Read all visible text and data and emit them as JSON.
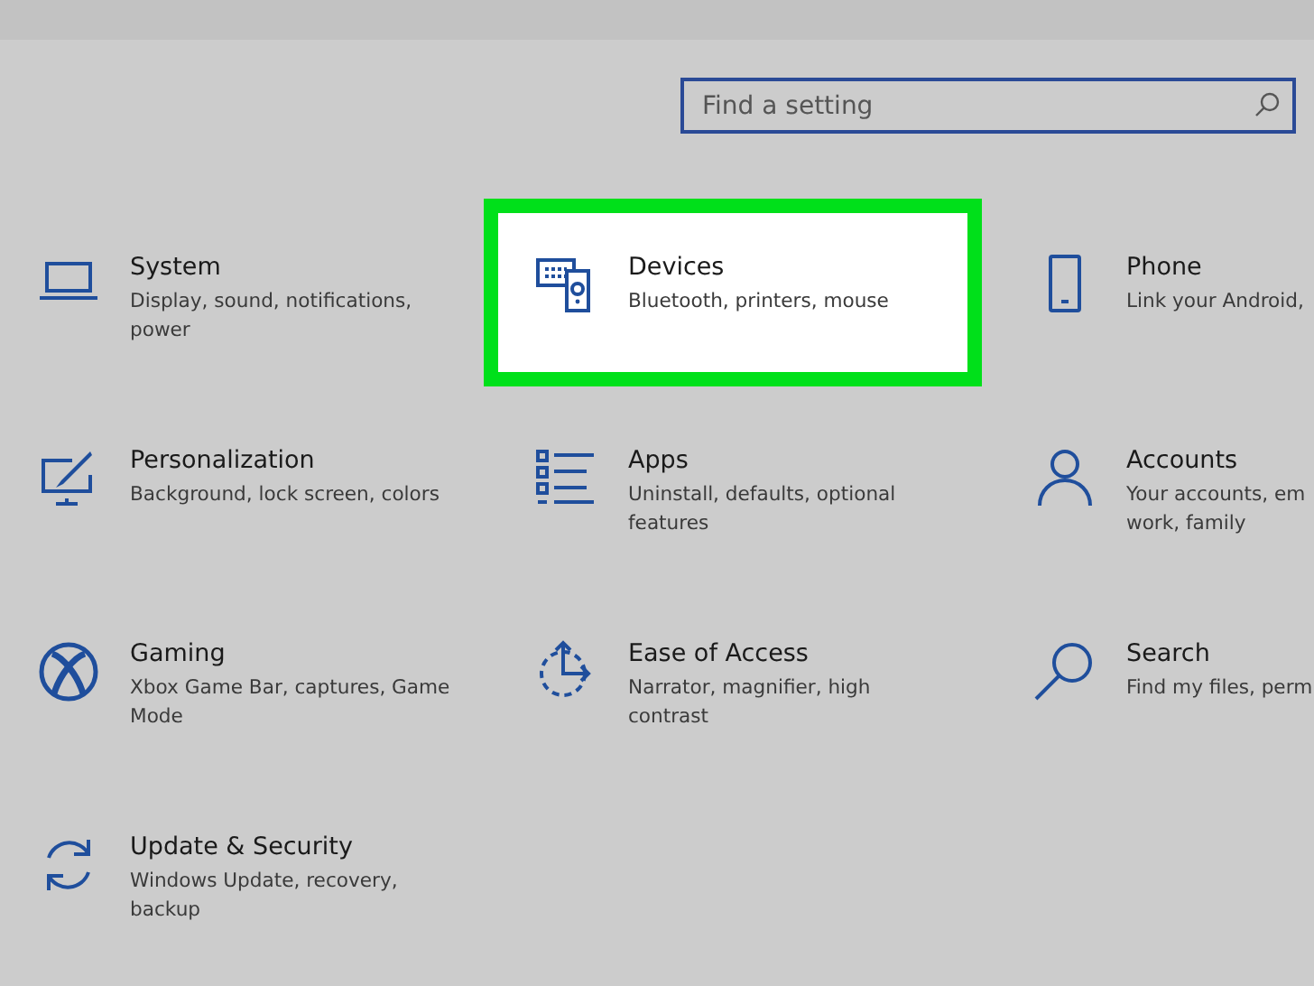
{
  "search": {
    "placeholder": "Find a setting"
  },
  "tiles": [
    {
      "title": "System",
      "description": "Display, sound, notifications,\npower",
      "highlighted": false
    },
    {
      "title": "Devices",
      "description": "Bluetooth, printers, mouse",
      "highlighted": true
    },
    {
      "title": "Phone",
      "description": "Link your Android,",
      "highlighted": false
    },
    {
      "title": "Personalization",
      "description": "Background, lock screen, colors",
      "highlighted": false
    },
    {
      "title": "Apps",
      "description": "Uninstall, defaults, optional\nfeatures",
      "highlighted": false
    },
    {
      "title": "Accounts",
      "description": "Your accounts, em\nwork, family",
      "highlighted": false
    },
    {
      "title": "Gaming",
      "description": "Xbox Game Bar, captures, Game\nMode",
      "highlighted": false
    },
    {
      "title": "Ease of Access",
      "description": "Narrator, magnifier, high\ncontrast",
      "highlighted": false
    },
    {
      "title": "Search",
      "description": "Find my files, perm",
      "highlighted": false
    },
    {
      "title": "Update & Security",
      "description": "Windows Update, recovery,\nbackup",
      "highlighted": false
    }
  ]
}
